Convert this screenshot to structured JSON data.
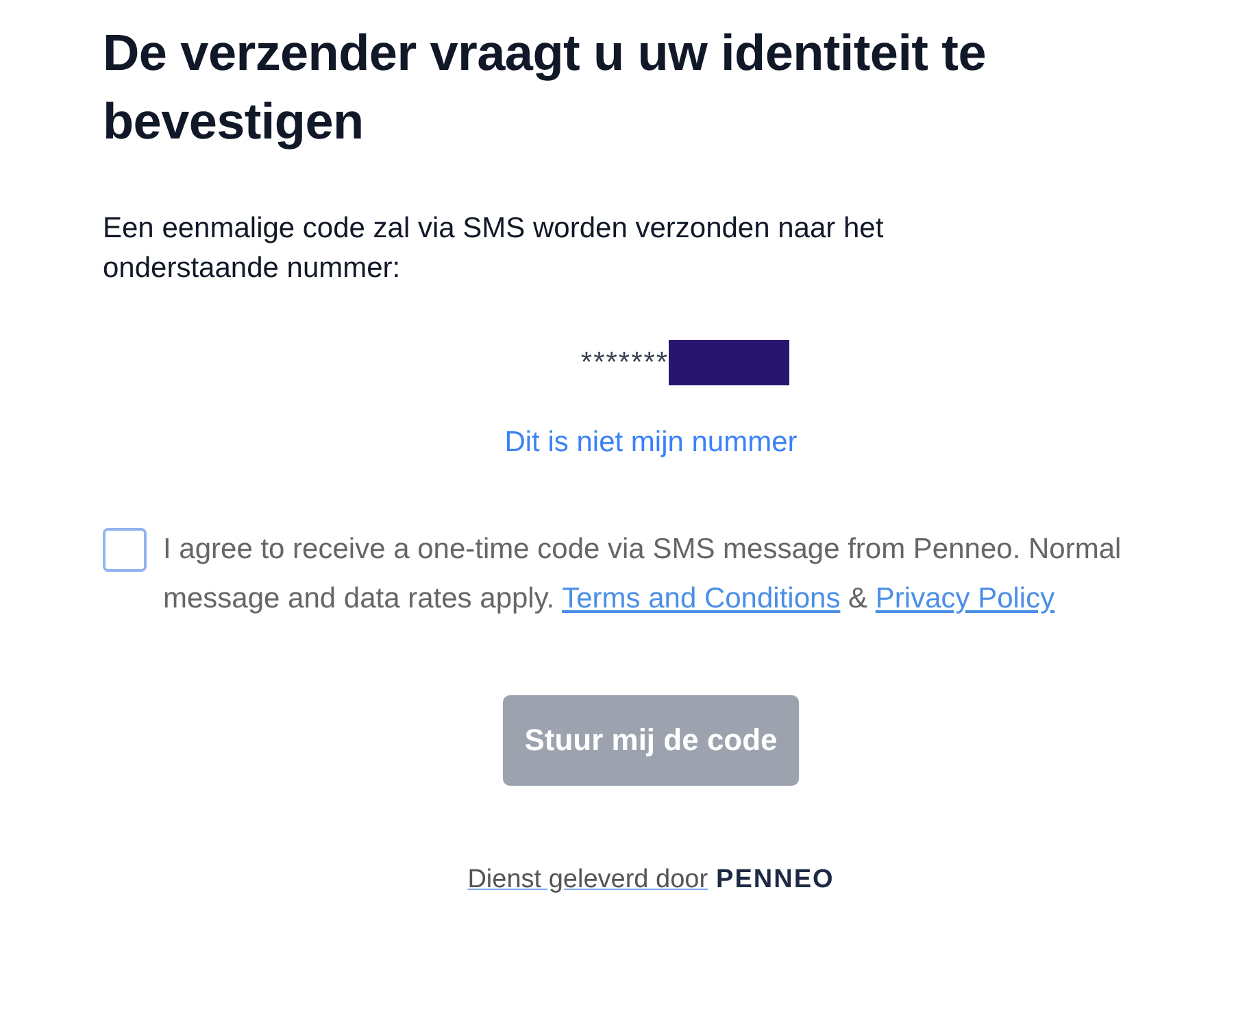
{
  "title": "De verzender vraagt u uw identiteit te bevestigen",
  "intro": "Een eenmalige code zal via SMS worden verzonden naar het onderstaande nummer:",
  "phone": {
    "masked": "*******",
    "redacted": true
  },
  "not_my_number_link": "Dit is niet mijn nummer",
  "consent": {
    "checked": false,
    "text": "I agree to receive a one-time code via SMS message from Penneo. Normal message and data rates apply.",
    "terms_link": "Terms and Conditions",
    "separator": "&",
    "privacy_link": "Privacy Policy"
  },
  "submit_button": {
    "label": "Stuur mij de code",
    "disabled": true
  },
  "footer": {
    "link": "Dienst geleverd door",
    "logo": "PENNEO"
  }
}
